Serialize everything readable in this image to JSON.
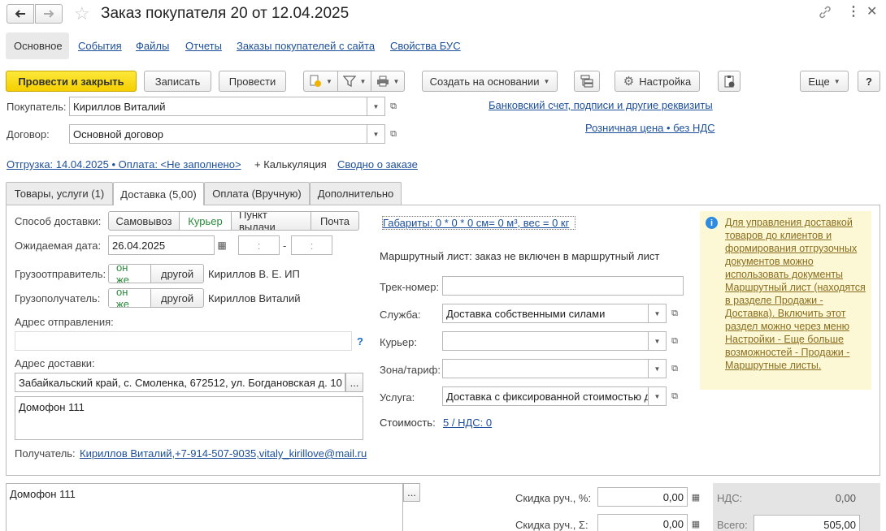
{
  "title": "Заказ покупателя 20 от 12.04.2025",
  "nav_tabs": [
    "Основное",
    "События",
    "Файлы",
    "Отчеты",
    "Заказы покупателей с сайта",
    "Свойства БУС"
  ],
  "toolbar": {
    "post_close": "Провести и закрыть",
    "save": "Записать",
    "post": "Провести",
    "create_based": "Создать на основании",
    "settings": "Настройка",
    "more": "Еще",
    "help": "?"
  },
  "header": {
    "buyer_label": "Покупатель:",
    "buyer_value": "Кириллов Виталий",
    "contract_label": "Договор:",
    "contract_value": "Основной договор",
    "bank_link": "Банковский счет, подписи и другие реквизиты",
    "price_link": "Розничная цена • без НДС",
    "shipment_link": "Отгрузка: 14.04.2025 • Оплата: <Не заполнено>",
    "calc_text": "+ Калькуляция",
    "summary_link": "Сводно о заказе"
  },
  "tabs": [
    "Товары, услуги (1)",
    "Доставка (5,00)",
    "Оплата (Вручную)",
    "Дополнительно"
  ],
  "delivery": {
    "method_label": "Способ доставки:",
    "methods": [
      "Самовывоз",
      "Курьер",
      "Пункт выдачи",
      "Почта"
    ],
    "date_label": "Ожидаемая дата:",
    "date_value": "26.04.2025",
    "time_from": ":",
    "time_sep": "-",
    "time_to": ":",
    "shipper_label": "Грузоотправитель:",
    "shipper_value": "Кириллов В. Е. ИП",
    "consignee_label": "Грузополучатель:",
    "consignee_value": "Кириллов Виталий",
    "same": "он же",
    "other": "другой",
    "from_address_label": "Адрес отправления:",
    "from_address_value": "",
    "help_q": "?",
    "address_label": "Адрес доставки:",
    "address_value": "Забайкальский край, с. Смоленка, 672512, ул. Богдановская д. 10",
    "address_comment": "Домофон 111",
    "recipient_label": "Получатель:",
    "recipient_value": "Кириллов Виталий,+7-914-507-9035,vitaly_kirillove@mail.ru",
    "dimensions_link": "Габариты: 0 * 0 * 0 см= 0 м³, вес = 0 кг",
    "route_text": "Маршрутный лист: заказ не включен в маршрутный лист",
    "track_label": "Трек-номер:",
    "track_value": "",
    "service_label": "Служба:",
    "service_value": "Доставка собственными силами",
    "courier_label": "Курьер:",
    "courier_value": "",
    "zone_label": "Зона/тариф:",
    "zone_value": "",
    "service2_label": "Услуга:",
    "service2_value": "Доставка с фиксированной стоимостью д",
    "cost_label": "Стоимость:",
    "cost_value": "5 / НДС: 0",
    "info_text": "Для управления доставкой товаров до клиентов и формирования отгрузочных документов можно использовать документы Маршрутный лист (находятся в разделе Продажи - Доставка). Включить этот раздел можно через меню Настройки - Еще больше возможностей - Продажи - Маршрутные листы."
  },
  "footer": {
    "comment": "Домофон 111",
    "discount_pct_label": "Скидка руч., %:",
    "discount_pct_value": "0,00",
    "discount_sum_label": "Скидка руч., Σ:",
    "discount_sum_value": "0,00",
    "vat_label": "НДС:",
    "vat_value": "0,00",
    "total_label": "Всего:",
    "total_value": "505,00"
  },
  "colors": {
    "primary": "#f5cf00",
    "link": "#1c4f9a",
    "info_bg": "#fcf8d6",
    "info_link": "#8a6d1e",
    "selected_green": "#2a8b3a"
  }
}
